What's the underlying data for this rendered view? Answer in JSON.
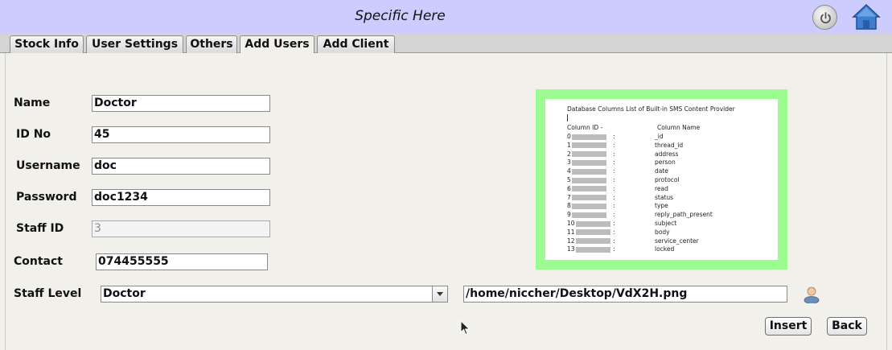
{
  "window": {
    "title": "Specific Here"
  },
  "icons": {
    "power": "power-icon",
    "home": "home-icon",
    "user": "user-icon",
    "cursor": "mouse-pointer-icon"
  },
  "tabs": [
    {
      "label": "Stock Info",
      "active": false
    },
    {
      "label": "User Settings",
      "active": false
    },
    {
      "label": "Others",
      "active": false
    },
    {
      "label": "Add Users",
      "active": true
    },
    {
      "label": "Add Client",
      "active": false
    }
  ],
  "form": {
    "name_label": "Name",
    "name_value": "Doctor",
    "id_label": "ID No",
    "id_value": "45",
    "username_label": "Username",
    "username_value": "doc",
    "password_label": "Password",
    "password_value": "doc1234",
    "staffid_label": "Staff ID",
    "staffid_value": "3",
    "contact_label": "Contact",
    "contact_value": "074455555",
    "stafflevel_label": "Staff Level",
    "stafflevel_value": "Doctor",
    "image_path": "/home/niccher/Desktop/VdX2H.png"
  },
  "preview": {
    "title": "Database Columns List of Built-in SMS Content Provider",
    "col_id_header": "Column ID  -",
    "col_name_header": "Column Name",
    "rows": [
      {
        "id": "0",
        "name": "_id"
      },
      {
        "id": "1",
        "name": "thread_id"
      },
      {
        "id": "2",
        "name": "address"
      },
      {
        "id": "3",
        "name": "person"
      },
      {
        "id": "4",
        "name": "date"
      },
      {
        "id": "5",
        "name": "protocol"
      },
      {
        "id": "6",
        "name": "read"
      },
      {
        "id": "7",
        "name": "status"
      },
      {
        "id": "8",
        "name": "type"
      },
      {
        "id": "9",
        "name": "reply_path_present"
      },
      {
        "id": "10",
        "name": "subject"
      },
      {
        "id": "11",
        "name": "body"
      },
      {
        "id": "12",
        "name": "service_center"
      },
      {
        "id": "13",
        "name": "locked"
      }
    ],
    "separator": ":"
  },
  "buttons": {
    "insert": "Insert",
    "back": "Back"
  },
  "colors": {
    "titlebar": "#ccccff",
    "preview_border": "#9cfc8f",
    "background": "#f2f0eb"
  }
}
